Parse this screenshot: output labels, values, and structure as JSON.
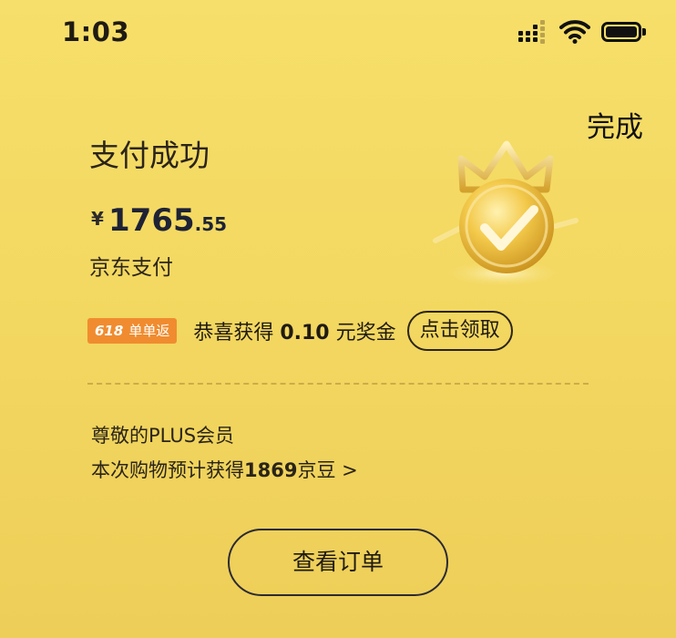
{
  "status_bar": {
    "time": "1:03",
    "icons": [
      "cellular-signal-icon",
      "wifi-icon",
      "battery-icon"
    ]
  },
  "header": {
    "done_label": "完成"
  },
  "payment": {
    "title": "支付成功",
    "currency_symbol": "¥",
    "amount_integer": "1765",
    "amount_decimal": ".55",
    "method": "京东支付"
  },
  "promo": {
    "badge_618": "618",
    "badge_label": "单单返",
    "text_prefix": "恭喜获得 ",
    "bonus_amount": "0.10",
    "text_suffix": " 元奖金",
    "claim_label": "点击领取",
    "badge_color": "#f08c2f"
  },
  "plus": {
    "line1": "尊敬的PLUS会员",
    "line2_prefix": "本次购物预计获得",
    "beans": "1869",
    "line2_suffix": "京豆 >"
  },
  "actions": {
    "view_order_label": "查看订单"
  },
  "colors": {
    "background": "#f3d861",
    "accent_orange": "#f08c2f",
    "dark_text": "#1f1a12"
  }
}
